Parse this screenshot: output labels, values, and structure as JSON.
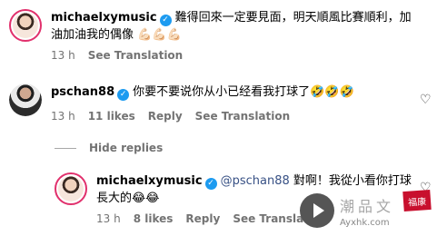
{
  "comments": [
    {
      "username": "michaelxymusic",
      "text_line1": "難得回來一定要見面，明天順風比賽順利，加",
      "text_line2": "油加油我的偶像 💪🏻💪🏻💪🏻",
      "time": "13 h",
      "likes": "",
      "reply": "",
      "see_translation": "See Translation"
    },
    {
      "username": "pschan88",
      "text_line1": "你要不要说你从小已经看我打球了🤣🤣🤣",
      "time": "13 h",
      "likes": "11 likes",
      "reply": "Reply",
      "see_translation": "See Translation"
    },
    {
      "username": "michaelxymusic",
      "mention": "@pschan88",
      "text_line1": " 對啊！我從小看你打球",
      "text_line2": "長大的😂😂",
      "time": "13 h",
      "likes": "8 likes",
      "reply": "Reply",
      "see_translation": "See Translation"
    }
  ],
  "hide_replies": "Hide replies",
  "icons": {
    "verified": "verified-badge-icon",
    "heart": "heart-icon",
    "play": "play-icon"
  },
  "watermark": {
    "title": "潮品文",
    "url": "Ayxhk.com",
    "seal": "福康"
  },
  "colors": {
    "verified": "#1d9bf0",
    "meta": "#737373",
    "mention": "#385185",
    "ring": "#e1306c"
  }
}
